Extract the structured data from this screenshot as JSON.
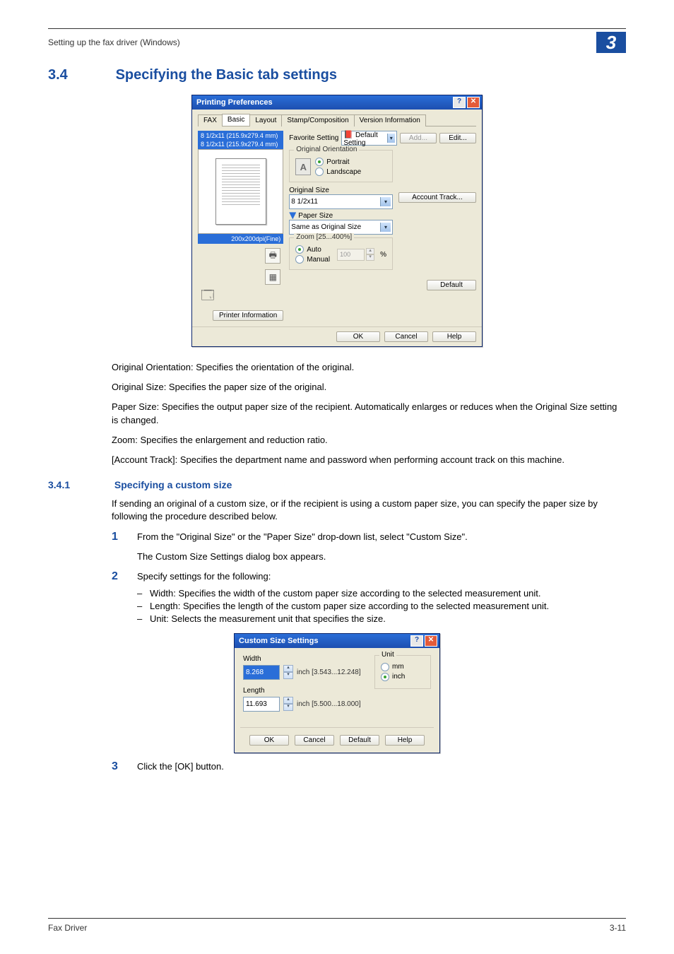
{
  "header": {
    "running_title": "Setting up the fax driver (Windows)",
    "chapter": "3"
  },
  "section": {
    "num": "3.4",
    "title": "Specifying the Basic tab settings"
  },
  "dlg1": {
    "title": "Printing Preferences",
    "tabs": [
      "FAX",
      "Basic",
      "Layout",
      "Stamp/Composition",
      "Version Information"
    ],
    "active_tab": 1,
    "preview_line1": "8 1/2x11 (215.9x279.4 mm)",
    "preview_line2": "8 1/2x11 (215.9x279.4 mm)",
    "preview_res": "200x200dpi(Fine)",
    "favorite_label": "Favorite Setting",
    "favorite_value": "Default Setting",
    "add_btn": "Add...",
    "edit_btn": "Edit...",
    "orient_group": "Original Orientation",
    "orient_portrait": "Portrait",
    "orient_landscape": "Landscape",
    "original_size_label": "Original Size",
    "original_size_value": "8 1/2x11",
    "paper_size_label": "Paper Size",
    "paper_size_value": "Same as Original Size",
    "zoom_group": "Zoom [25...400%]",
    "zoom_auto": "Auto",
    "zoom_manual": "Manual",
    "zoom_value": "100",
    "zoom_pct": "%",
    "account_btn": "Account Track...",
    "printer_info_btn": "Printer Information",
    "default_btn": "Default",
    "ok": "OK",
    "cancel": "Cancel",
    "help": "Help"
  },
  "body": {
    "p1": "Original Orientation: Specifies the orientation of the original.",
    "p2": "Original Size: Specifies the paper size of the original.",
    "p3": "Paper Size: Specifies the output paper size of the recipient. Automatically enlarges or reduces when the Original Size setting is changed.",
    "p4": "Zoom: Specifies the enlargement and reduction ratio.",
    "p5": "[Account Track]: Specifies the department name and password when performing account track on this machine."
  },
  "subsection": {
    "num": "3.4.1",
    "title": "Specifying a custom size"
  },
  "sub_body": {
    "intro": "If sending an original of a custom size, or if the recipient is using a custom paper size, you can specify the paper size by following the procedure described below.",
    "s1a": "From the \"Original Size\" or the \"Paper Size\" drop-down list, select \"Custom Size\".",
    "s1b": "The Custom Size Settings dialog box appears.",
    "s2a": "Specify settings for the following:",
    "s2_w": "Width: Specifies the width of the custom paper size according to the selected measurement unit.",
    "s2_l": "Length: Specifies the length of the custom paper size according to the selected measurement unit.",
    "s2_u": "Unit: Selects the measurement unit that specifies the size.",
    "s3": "Click the [OK] button."
  },
  "dlg2": {
    "title": "Custom Size Settings",
    "width_label": "Width",
    "width_value": "8.268",
    "width_range": "inch [3.543...12.248]",
    "length_label": "Length",
    "length_value": "11.693",
    "length_range": "inch [5.500...18.000]",
    "unit_group": "Unit",
    "unit_mm": "mm",
    "unit_inch": "inch",
    "ok": "OK",
    "cancel": "Cancel",
    "default": "Default",
    "help": "Help"
  },
  "footer": {
    "left": "Fax Driver",
    "right": "3-11"
  }
}
